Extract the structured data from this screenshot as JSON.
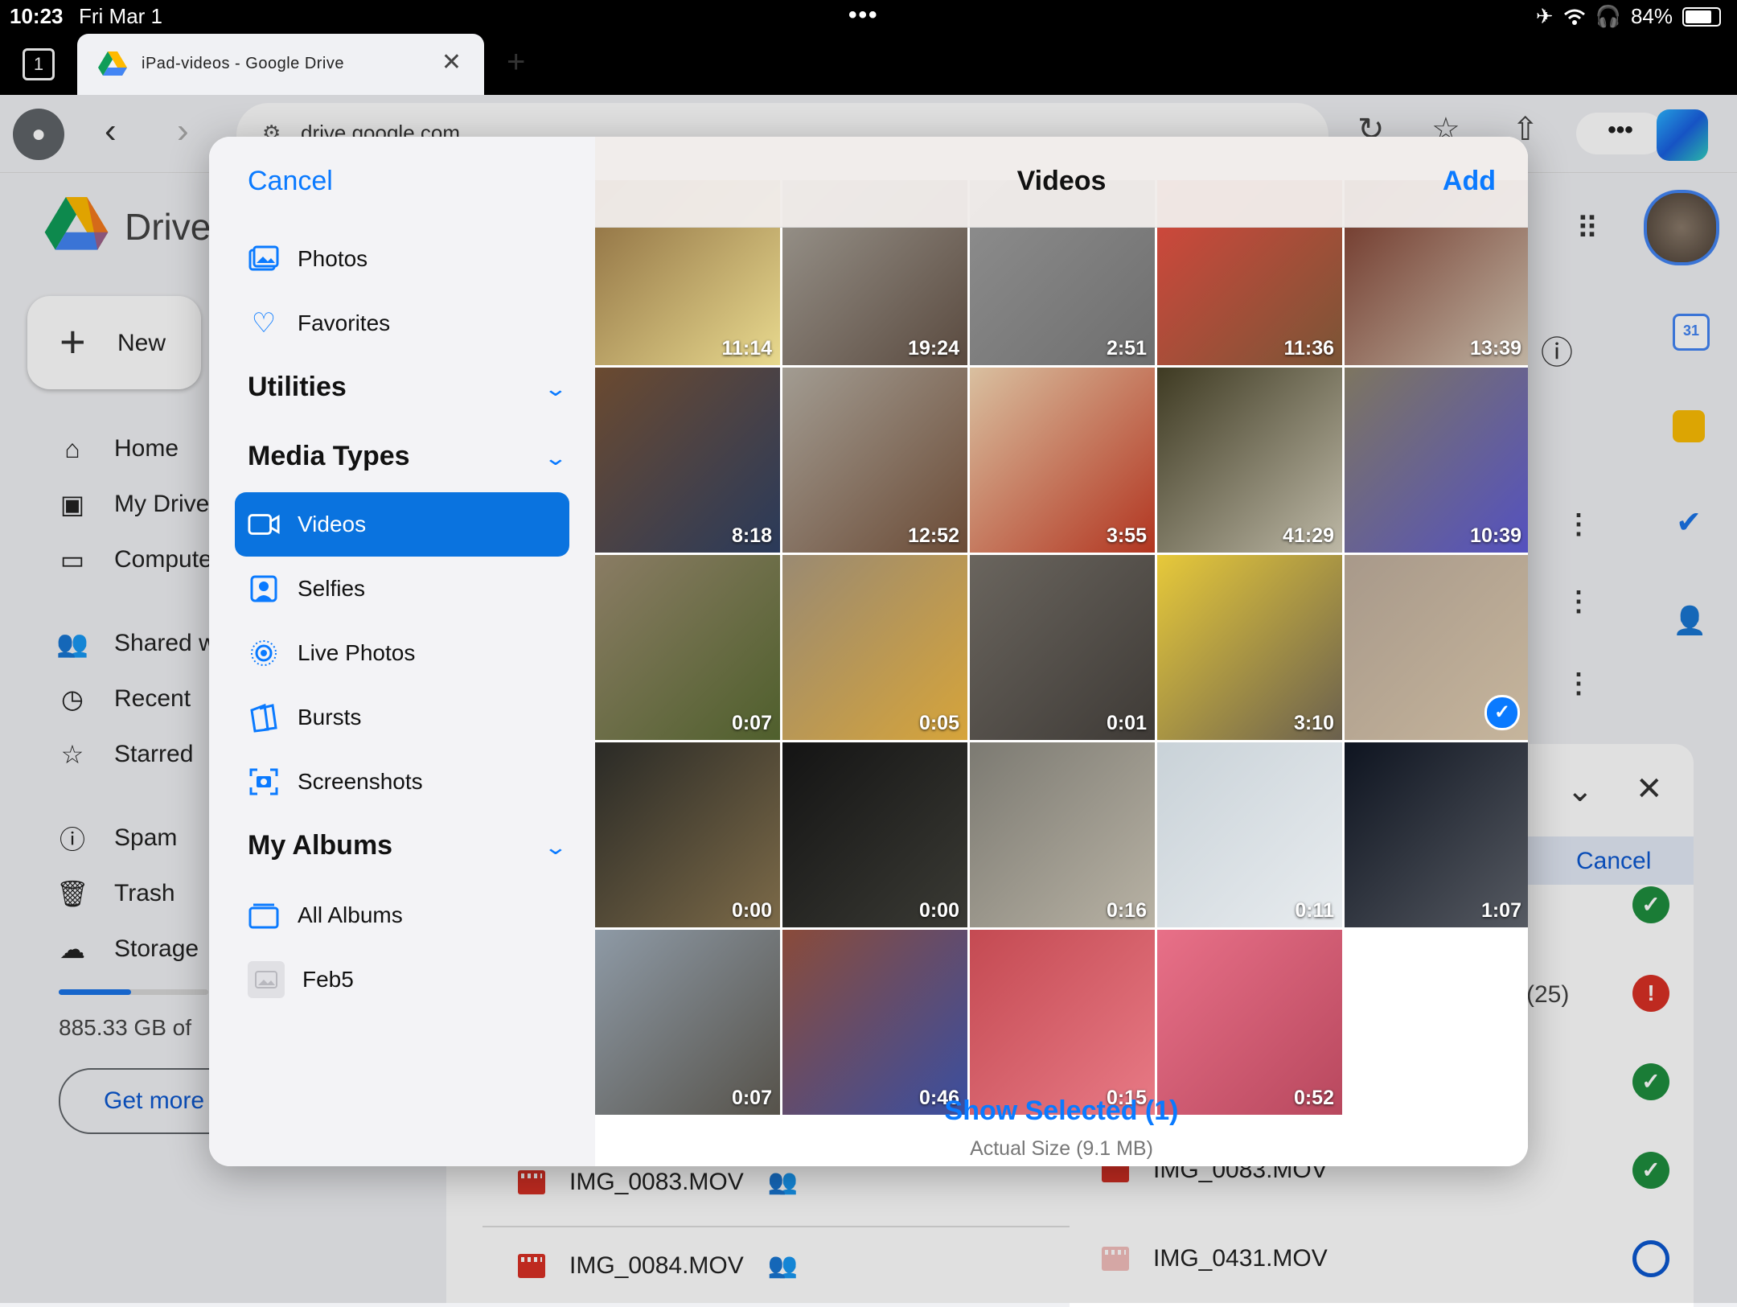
{
  "status_bar": {
    "time": "10:23",
    "date": "Fri Mar 1",
    "battery": "84%"
  },
  "browser": {
    "tab_count": "1",
    "tab_title": "iPad-videos - Google Drive",
    "url": "drive.google.com"
  },
  "drive": {
    "app_name": "Drive",
    "new_label": "New",
    "nav": [
      {
        "label": "Home",
        "icon": "home-icon"
      },
      {
        "label": "My Drive",
        "icon": "drive-icon"
      },
      {
        "label": "Computers",
        "icon": "computer-icon"
      },
      {
        "label": "Shared with me",
        "icon": "people-icon"
      },
      {
        "label": "Recent",
        "icon": "clock-icon"
      },
      {
        "label": "Starred",
        "icon": "star-icon"
      },
      {
        "label": "Spam",
        "icon": "alert-icon"
      },
      {
        "label": "Trash",
        "icon": "trash-icon"
      },
      {
        "label": "Storage",
        "icon": "cloud-icon"
      }
    ],
    "storage_text": "885.33 GB of",
    "get_more": "Get more",
    "files": [
      "IMG_0083.MOV",
      "IMG_0084.MOV"
    ],
    "upload_panel": {
      "cancel": "Cancel",
      "count_text": "(25)",
      "files": [
        "IMG_0083.MOV",
        "IMG_0431.MOV"
      ]
    }
  },
  "picker": {
    "cancel": "Cancel",
    "title": "Videos",
    "add": "Add",
    "top_items": [
      {
        "label": "Photos",
        "icon": "photos-icon"
      },
      {
        "label": "Favorites",
        "icon": "heart-icon"
      }
    ],
    "utilities_header": "Utilities",
    "media_types_header": "Media Types",
    "media_types": [
      {
        "label": "Videos",
        "icon": "video-icon"
      },
      {
        "label": "Selfies",
        "icon": "selfie-icon"
      },
      {
        "label": "Live Photos",
        "icon": "live-photo-icon"
      },
      {
        "label": "Bursts",
        "icon": "bursts-icon"
      },
      {
        "label": "Screenshots",
        "icon": "screenshot-icon"
      }
    ],
    "my_albums_header": "My Albums",
    "albums": [
      {
        "label": "All Albums",
        "icon": "albums-icon"
      },
      {
        "label": "Feb5",
        "icon": "album-thumb-icon"
      }
    ],
    "videos": [
      {
        "duration": "11:14",
        "colors": [
          "#8a6a3e",
          "#e8d98e"
        ],
        "selected": false
      },
      {
        "duration": "19:24",
        "colors": [
          "#9c9890",
          "#5a4a3f"
        ],
        "selected": false
      },
      {
        "duration": "2:51",
        "colors": [
          "#8f8f8f",
          "#6e6e6e"
        ],
        "selected": false
      },
      {
        "duration": "11:36",
        "colors": [
          "#d8463c",
          "#7a5536"
        ],
        "selected": false
      },
      {
        "duration": "13:39",
        "colors": [
          "#6b2f22",
          "#bfb3a2"
        ],
        "selected": false
      },
      {
        "duration": "8:18",
        "colors": [
          "#6b4a30",
          "#2a3a5a"
        ],
        "selected": false
      },
      {
        "duration": "12:52",
        "colors": [
          "#a29c92",
          "#6b4b36"
        ],
        "selected": false
      },
      {
        "duration": "3:55",
        "colors": [
          "#d9c0a0",
          "#b23520"
        ],
        "selected": false
      },
      {
        "duration": "41:29",
        "colors": [
          "#3e3a22",
          "#bdb8a6"
        ],
        "selected": false
      },
      {
        "duration": "10:39",
        "colors": [
          "#7d7560",
          "#5451c0"
        ],
        "selected": false
      },
      {
        "duration": "0:07",
        "colors": [
          "#8a7c64",
          "#4f5f2c"
        ],
        "selected": false
      },
      {
        "duration": "0:05",
        "colors": [
          "#9a8a72",
          "#d6a43a"
        ],
        "selected": false
      },
      {
        "duration": "0:01",
        "colors": [
          "#6a655e",
          "#3e3a36"
        ],
        "selected": false
      },
      {
        "duration": "3:10",
        "colors": [
          "#e7c93a",
          "#6a604e"
        ],
        "selected": false
      },
      {
        "duration": "",
        "colors": [
          "#a8998a",
          "#c6b59c"
        ],
        "selected": true
      },
      {
        "duration": "0:00",
        "colors": [
          "#2a2a26",
          "#7c6a48"
        ],
        "selected": false
      },
      {
        "duration": "0:00",
        "colors": [
          "#141414",
          "#3a3a34"
        ],
        "selected": false
      },
      {
        "duration": "0:16",
        "colors": [
          "#7c7a72",
          "#b8b2a4"
        ],
        "selected": false
      },
      {
        "duration": "0:11",
        "colors": [
          "#c9d2d8",
          "#e8ecef"
        ],
        "selected": false
      },
      {
        "duration": "1:07",
        "colors": [
          "#0e1420",
          "#565a62"
        ],
        "selected": false
      },
      {
        "duration": "0:07",
        "colors": [
          "#8e9aa6",
          "#56524a"
        ],
        "selected": false
      },
      {
        "duration": "0:46",
        "colors": [
          "#8a4b3a",
          "#3a4ea0"
        ],
        "selected": false
      },
      {
        "duration": "0:15",
        "colors": [
          "#c44a52",
          "#e87a86"
        ],
        "selected": false
      },
      {
        "duration": "0:52",
        "colors": [
          "#e87088",
          "#b8485e"
        ],
        "selected": false
      }
    ],
    "show_selected": "Show Selected (1)",
    "actual_size": "Actual Size (9.1 MB)"
  },
  "colors": {
    "accent": "#0a7aff",
    "selected_row": "#0a73df",
    "drive_blue": "#0b57d0"
  }
}
